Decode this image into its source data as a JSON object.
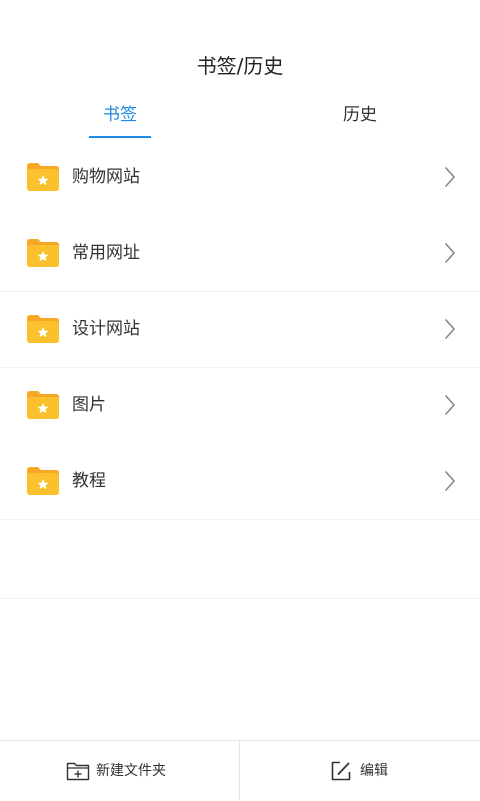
{
  "header": {
    "title": "书签/历史"
  },
  "tabs": [
    {
      "label": "书签",
      "active": true
    },
    {
      "label": "历史",
      "active": false
    }
  ],
  "colors": {
    "accent": "#1e88e5",
    "folder": "#fbc02d",
    "folder_tab": "#f9a825"
  },
  "bookmark_folders": [
    {
      "label": "购物网站",
      "icon": "folder-star-icon"
    },
    {
      "label": "常用网址",
      "icon": "folder-star-icon"
    },
    {
      "label": "设计网站",
      "icon": "folder-star-icon"
    },
    {
      "label": "图片",
      "icon": "folder-star-icon"
    },
    {
      "label": "教程",
      "icon": "folder-star-icon"
    }
  ],
  "bottom_bar": {
    "new_folder_label": "新建文件夹",
    "edit_label": "编辑"
  }
}
